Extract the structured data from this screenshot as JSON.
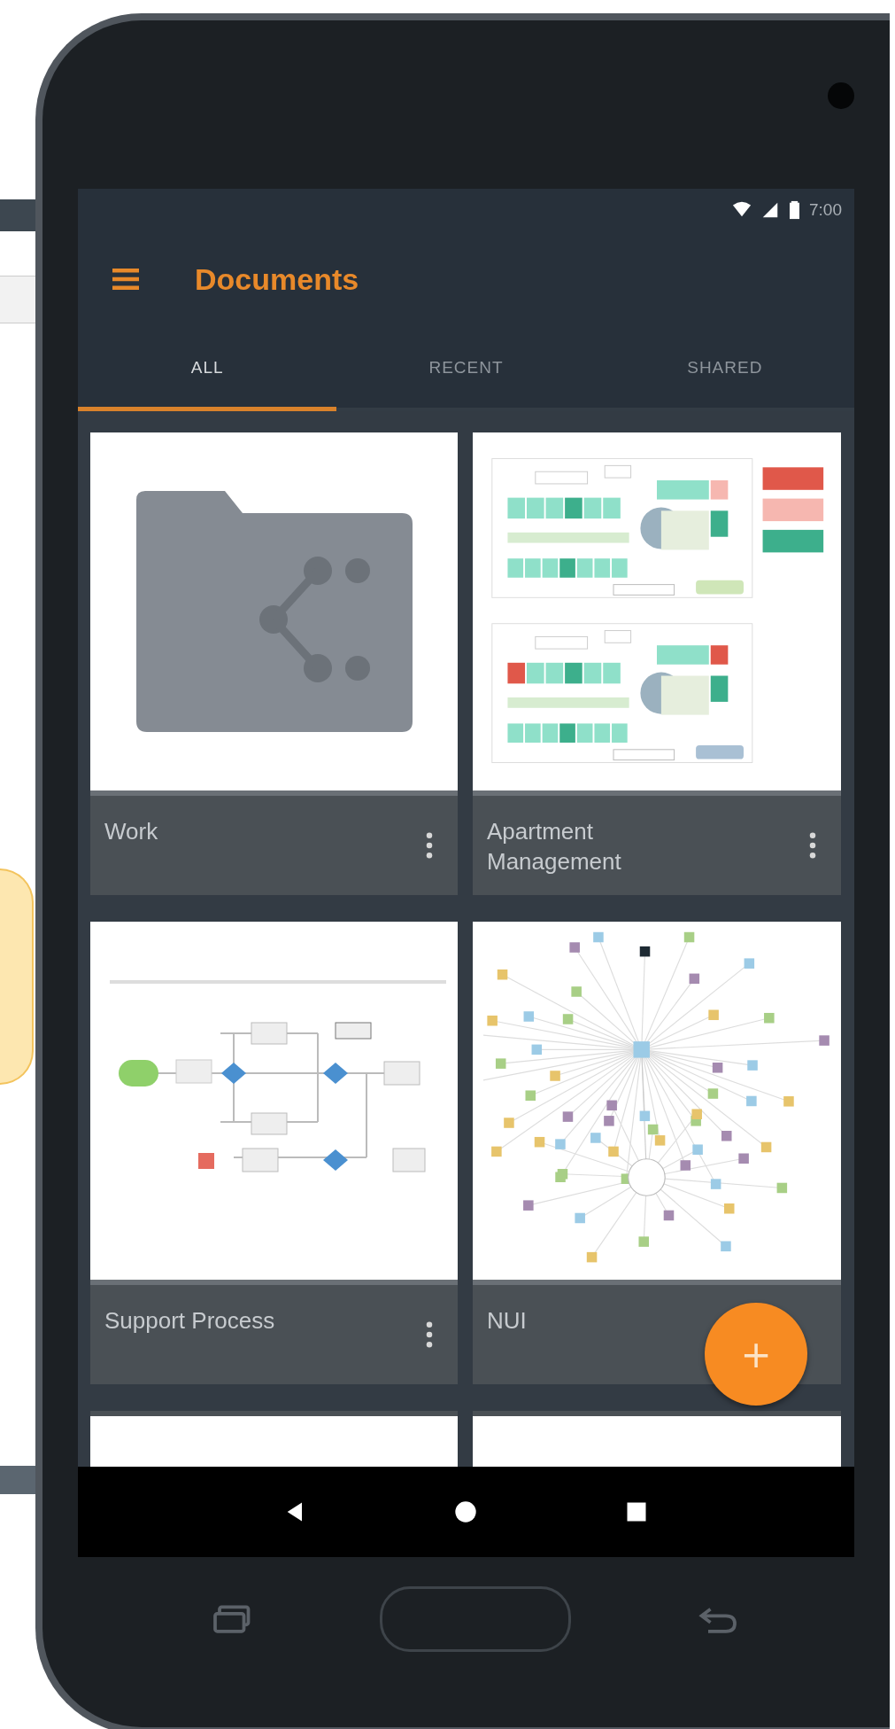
{
  "status_bar": {
    "time": "7:00"
  },
  "app_bar": {
    "title": "Documents"
  },
  "tabs": [
    {
      "label": "ALL",
      "selected": true
    },
    {
      "label": "RECENT",
      "selected": false
    },
    {
      "label": "SHARED",
      "selected": false
    }
  ],
  "documents": [
    {
      "kind": "shared-folder",
      "title": "Work",
      "menu": true
    },
    {
      "kind": "floor-plan",
      "title": "Apartment Management",
      "menu": true
    },
    {
      "kind": "flowchart",
      "title": "Support Process",
      "menu": true
    },
    {
      "kind": "network",
      "title": "NUI",
      "menu": false
    },
    {
      "kind": "cutoff"
    },
    {
      "kind": "cutoff"
    }
  ],
  "fab": {
    "label": "+"
  }
}
